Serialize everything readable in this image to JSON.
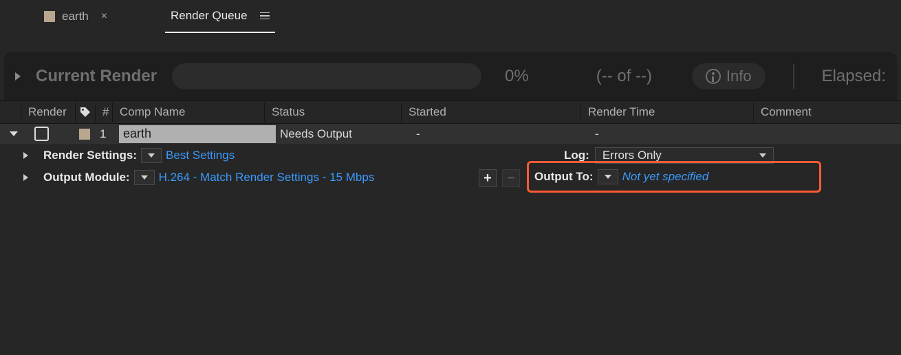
{
  "tabs": {
    "comp": {
      "name": "earth"
    },
    "queue": {
      "name": "Render Queue"
    }
  },
  "currentRender": {
    "label": "Current Render",
    "percent": "0%",
    "count": "(-- of --)",
    "info": "Info",
    "elapsed": "Elapsed:"
  },
  "columns": {
    "render": "Render",
    "hash": "#",
    "compName": "Comp Name",
    "status": "Status",
    "started": "Started",
    "renderTime": "Render Time",
    "comment": "Comment"
  },
  "item": {
    "index": "1",
    "compName": "earth",
    "status": "Needs Output",
    "started": "-",
    "renderTime": "-"
  },
  "renderSettings": {
    "label": "Render Settings:",
    "value": "Best Settings"
  },
  "log": {
    "label": "Log:",
    "value": "Errors Only"
  },
  "outputModule": {
    "label": "Output Module:",
    "value": "H.264 - Match Render Settings - 15 Mbps"
  },
  "outputTo": {
    "label": "Output To:",
    "value": "Not yet specified"
  },
  "buttons": {
    "plus": "+",
    "minus": "−"
  }
}
